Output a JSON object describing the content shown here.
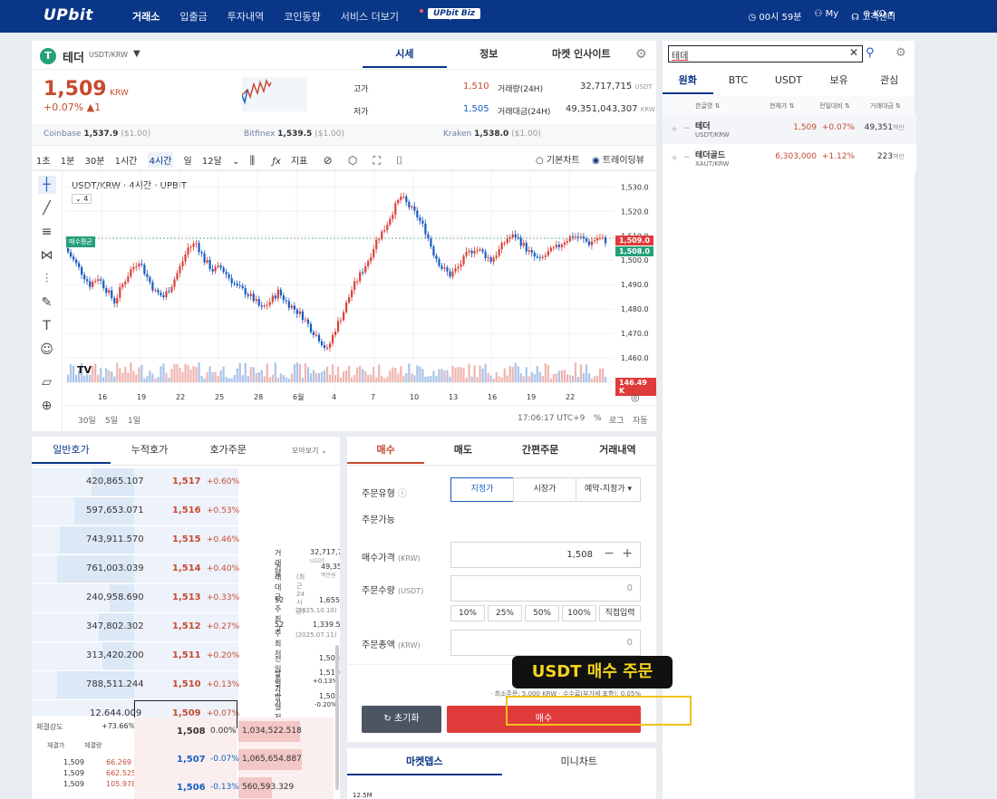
{
  "header": {
    "logo": "UPbit",
    "nav": [
      "거래소",
      "입출금",
      "투자내역",
      "코인동향",
      "서비스 더보기"
    ],
    "biz": "UPbit Biz",
    "timer": "00시 59분",
    "my": "My",
    "support": "고객센터",
    "lang": "KO"
  },
  "coin": {
    "name": "테더",
    "pair": "USDT/KRW",
    "price": "1,509",
    "price_unit": "KRW",
    "change_pct": "+0.07%",
    "change_abs": "▲1",
    "tabs": [
      "시세",
      "정보",
      "마켓 인사이트"
    ],
    "high_label": "고가",
    "high": "1,510",
    "low_label": "저가",
    "low": "1,505",
    "vol_label": "거래량(24H)",
    "vol": "32,717,715",
    "vol_unit": "USDT",
    "amt_label": "거래대금(24H)",
    "amt": "49,351,043,307",
    "amt_unit": "KRW",
    "ex1": "Coinbase",
    "ex1_val": "1,537.9",
    "ex1_usd": "($1.00)",
    "ex2": "Bitfinex",
    "ex2_val": "1,539.5",
    "ex2_usd": "($1.00)",
    "ex3": "Kraken",
    "ex3_val": "1,538.0",
    "ex3_usd": "($1.00)"
  },
  "chart_toolbar": {
    "intervals": [
      "1초",
      "1분",
      "30분",
      "1시간",
      "4시간",
      "일",
      "12달"
    ],
    "indicator": "지표",
    "basic": "기본차트",
    "tv": "트레이딩뷰"
  },
  "chart": {
    "title": "USDT/KRW · 4시간 · UPBIT",
    "indicator_count": "4",
    "avg_label": "매수평균",
    "price_tag_red": "1,509.0",
    "price_tag_green": "1,508.0",
    "vol_tag": "146.49 K",
    "y_ticks": [
      "1,530.0",
      "1,520.0",
      "1,510.0",
      "1,500.0",
      "1,490.0",
      "1,480.0",
      "1,470.0",
      "1,460.0",
      "1,450.0"
    ],
    "x_ticks": [
      "16",
      "19",
      "22",
      "25",
      "28",
      "6월",
      "4",
      "7",
      "10",
      "13",
      "16",
      "19",
      "22"
    ],
    "range_btns": [
      "30일",
      "5일",
      "1일"
    ],
    "time": "17:06:17 UTC+9",
    "pct": "%",
    "log": "로그",
    "auto": "자동"
  },
  "chart_data": {
    "type": "line",
    "title": "USDT/KRW · 4시간 · UPBIT",
    "ylim": [
      1450,
      1532
    ],
    "x_ticks": [
      "16",
      "19",
      "22",
      "25",
      "28",
      "6월",
      "4",
      "7",
      "10",
      "13",
      "16",
      "19",
      "22"
    ],
    "values": [
      1505,
      1500,
      1495,
      1490,
      1493,
      1488,
      1483,
      1490,
      1496,
      1500,
      1493,
      1487,
      1485,
      1490,
      1497,
      1505,
      1507,
      1500,
      1496,
      1497,
      1493,
      1489,
      1487,
      1484,
      1480,
      1483,
      1487,
      1483,
      1480,
      1477,
      1472,
      1468,
      1463,
      1472,
      1479,
      1488,
      1494,
      1500,
      1508,
      1513,
      1520,
      1526,
      1522,
      1518,
      1512,
      1503,
      1497,
      1494,
      1497,
      1502,
      1505,
      1503,
      1500,
      1504,
      1509,
      1510,
      1506,
      1502,
      1500,
      1503,
      1505,
      1508,
      1510,
      1509,
      1507,
      1509,
      1508
    ],
    "grid": true
  },
  "orderbook": {
    "tabs": [
      "일반호가",
      "누적호가",
      "호가주문"
    ],
    "more": "모아보기",
    "asks": [
      {
        "qty": "420,865.107",
        "price": "1,517",
        "chg": "+0.60%",
        "w": 0.55
      },
      {
        "qty": "597,653.071",
        "price": "1,516",
        "chg": "+0.53%",
        "w": 0.78
      },
      {
        "qty": "743,911.570",
        "price": "1,515",
        "chg": "+0.46%",
        "w": 0.97
      },
      {
        "qty": "761,003.039",
        "price": "1,514",
        "chg": "+0.40%",
        "w": 1.0
      },
      {
        "qty": "240,958.690",
        "price": "1,513",
        "chg": "+0.33%",
        "w": 0.32
      },
      {
        "qty": "347,802.302",
        "price": "1,512",
        "chg": "+0.27%",
        "w": 0.46
      },
      {
        "qty": "313,420.200",
        "price": "1,511",
        "chg": "+0.20%",
        "w": 0.41
      },
      {
        "qty": "788,511.244",
        "price": "1,510",
        "chg": "+0.13%",
        "w": 1.03
      },
      {
        "qty": "12,644.009",
        "price": "1,509",
        "chg": "+0.07%",
        "w": 0.02
      }
    ],
    "bids": [
      {
        "price": "1,508",
        "chg": "0.00%",
        "qty": "1,034,522.518"
      },
      {
        "price": "1,507",
        "chg": "-0.07%",
        "qty": "1,065,654.887"
      },
      {
        "price": "1,506",
        "chg": "-0.13%",
        "qty": "560,593.329"
      }
    ],
    "strength_label": "체결강도",
    "strength": "+73.66%",
    "trade_hdr": [
      "체결가",
      "체결량"
    ],
    "trades": [
      [
        "1,509",
        "66.269"
      ],
      [
        "1,509",
        "662.525"
      ],
      [
        "1,509",
        "105.978"
      ]
    ],
    "stats": {
      "vol_l": "거래량",
      "vol": "32,717,715",
      "vol_u": "USDT",
      "amt_l": "거래대금",
      "amt": "49,351",
      "amt_u": "백만원",
      "amt_note": "(최근24시간)",
      "hi52_l": "52주 최고",
      "hi52": "1,655",
      "hi52_d": "(2025.10.10)",
      "lo52_l": "52주 최저",
      "lo52": "1,339.5",
      "lo52_d": "(2025.07.11)",
      "prev_l": "전일종가",
      "prev": "1,508",
      "dhi_l": "당일고가",
      "dhi": "1,510",
      "dhi_p": "+0.13%",
      "dlo_l": "당일저가",
      "dlo": "1,505",
      "dlo_p": "-0.20%"
    }
  },
  "order": {
    "tabs": [
      "매수",
      "매도",
      "간편주문",
      "거래내역"
    ],
    "type_label": "주문유형",
    "types": [
      "지정가",
      "시장가",
      "예약-지정가"
    ],
    "avail_label": "주문가능",
    "price_label": "매수가격",
    "price_unit": "(KRW)",
    "price_val": "1,508",
    "qty_label": "주문수량",
    "qty_unit": "(USDT)",
    "qty_val": "0",
    "pcts": [
      "10%",
      "25%",
      "50%",
      "100%",
      "직접입력"
    ],
    "total_label": "주문총액",
    "total_unit": "(KRW)",
    "total_val": "0",
    "note": "· 최소주문: 5,000 KRW · 수수료(부가세 포함): 0.05%",
    "reset": "초기화",
    "buy": "매수"
  },
  "bottom_tabs": [
    "마켓뎁스",
    "미니차트"
  ],
  "depth_tick": "12.5M",
  "market": {
    "search_value": "테데",
    "tabs": [
      "원화",
      "BTC",
      "USDT",
      "보유",
      "관심"
    ],
    "cols": [
      "한글명",
      "현재가",
      "전일대비",
      "거래대금"
    ],
    "rows": [
      {
        "name": "테더",
        "pair": "USDT/KRW",
        "price": "1,509",
        "chg": "+0.07%",
        "amt": "49,351",
        "unit": "백만"
      },
      {
        "name": "테더골드",
        "pair": "XAUT/KRW",
        "price": "6,303,000",
        "chg": "+1.12%",
        "amt": "223",
        "unit": "백만"
      }
    ]
  },
  "annotation": "USDT 매수 주문",
  "colors": {
    "brand": "#093687",
    "up": "#c84a31",
    "down": "#1261c4",
    "buy": "#e03b3b"
  }
}
